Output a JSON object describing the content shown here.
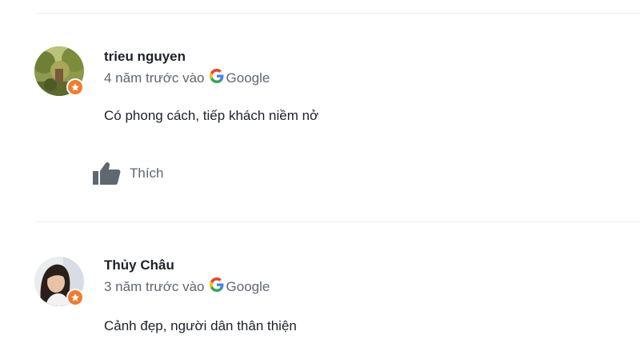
{
  "reviews": [
    {
      "author": "trieu nguyen",
      "time": "4 năm trước vào",
      "source": "Google",
      "text": "Có phong cách, tiếp khách niềm nở",
      "avatar": "landscape-photo-avatar",
      "badge": "local-guide-star-icon",
      "like_label": "Thích"
    },
    {
      "author": "Thủy Châu",
      "time": "3 năm trước vào",
      "source": "Google",
      "text": "Cảnh đẹp, người dân thân thiện",
      "avatar": "woman-portrait-avatar",
      "badge": "local-guide-star-icon"
    }
  ],
  "colors": {
    "author": "#1d2129",
    "meta": "#606770",
    "badge": "#f27a2c",
    "divider": "#eceef1",
    "like_icon": "#606770"
  }
}
